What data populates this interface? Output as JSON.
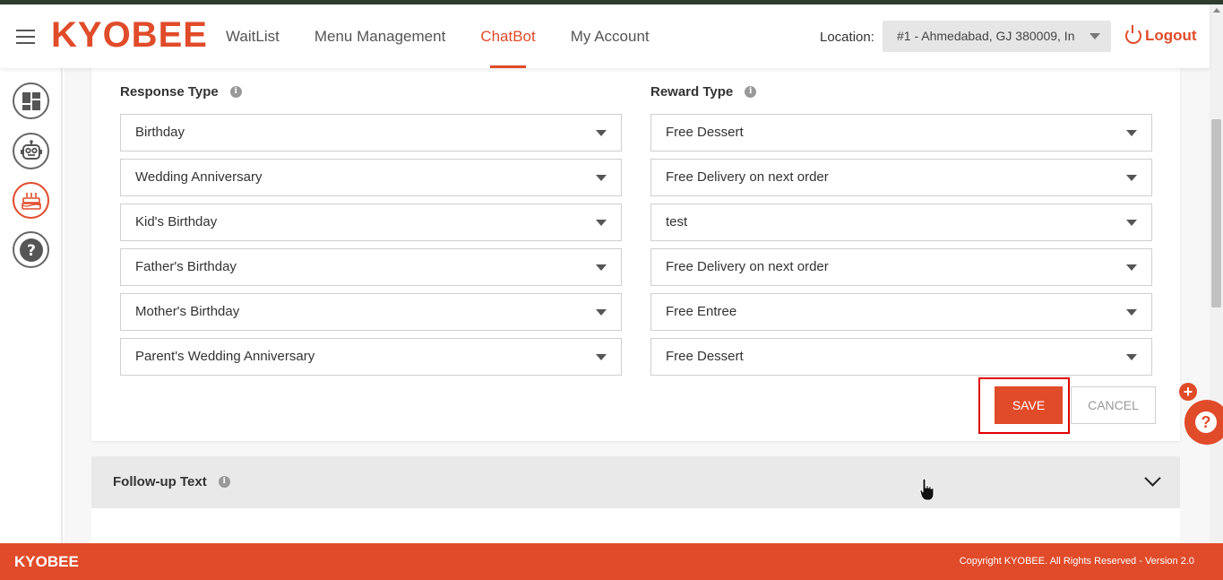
{
  "header": {
    "logo": "KYOBEE",
    "nav": [
      "WaitList",
      "Menu Management",
      "ChatBot",
      "My Account"
    ],
    "active_nav": "ChatBot",
    "location_label": "Location:",
    "location_value": "#1 - Ahmedabad, GJ 380009, In",
    "logout_label": "Logout"
  },
  "sidebar": {
    "items": [
      "dashboard-icon",
      "chatbot-icon",
      "birthday-cake-icon",
      "help-icon"
    ],
    "active": "birthday-cake-icon"
  },
  "form": {
    "response_type_label": "Response Type",
    "reward_type_label": "Reward Type",
    "rows": [
      {
        "response": "Birthday",
        "reward": "Free Dessert"
      },
      {
        "response": "Wedding Anniversary",
        "reward": "Free Delivery on next order"
      },
      {
        "response": "Kid's Birthday",
        "reward": "test"
      },
      {
        "response": "Father's Birthday",
        "reward": "Free Delivery on next order"
      },
      {
        "response": "Mother's Birthday",
        "reward": "Free Entree"
      },
      {
        "response": "Parent's Wedding Anniversary",
        "reward": "Free Dessert"
      }
    ],
    "save_label": "SAVE",
    "cancel_label": "CANCEL"
  },
  "followup": {
    "label": "Follow-up Text"
  },
  "footer": {
    "brand": "KYOBEE",
    "copyright": "Copyright KYOBEE. All Rights Reserved - Version 2.0"
  },
  "colors": {
    "accent": "#e04b2a",
    "highlight_border": "#e00000"
  }
}
